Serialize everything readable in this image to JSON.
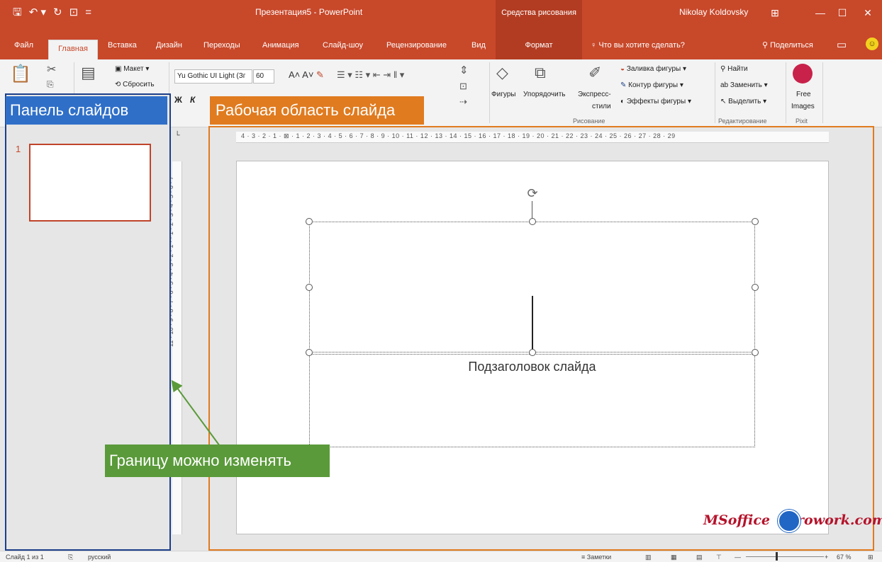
{
  "window": {
    "qat_icons": [
      "save-icon",
      "undo-icon",
      "redo-icon",
      "start-slideshow-icon",
      "customize-qat-icon"
    ],
    "qat_glyphs": [
      "🖫",
      "↶ ▾",
      "↻",
      "⊡",
      "="
    ],
    "document_title": "Презентация5 - PowerPoint",
    "contextual_group": "Средства рисования",
    "user": "Nikolay Koldovsky",
    "controls": [
      "⊞",
      "—",
      "☐",
      "✕"
    ]
  },
  "tabs": {
    "file": "Файл",
    "home": "Главная",
    "insert": "Вставка",
    "design": "Дизайн",
    "transitions": "Переходы",
    "animations": "Анимация",
    "slideshow": "Слайд-шоу",
    "review": "Рецензирование",
    "view": "Вид",
    "format": "Формат",
    "tell_me": "Что вы хотите сделать?",
    "tell_me_icon": "lightbulb-icon",
    "share": "Поделиться",
    "share_icon": "person-icon"
  },
  "ribbon": {
    "layout_label": "Макет",
    "reset_label": "Сбросить",
    "font_name": "Yu Gothic UI Light (Зг",
    "font_size": "60",
    "bold": "Ж",
    "italic": "К",
    "shapes_label": "Фигуры",
    "arrange_label": "Упорядочить",
    "quick_styles_label": "Экспресс-",
    "quick_styles_label2": "стили",
    "shape_fill": "Заливка фигуры",
    "shape_outline": "Контур фигуры",
    "shape_effects": "Эффекты фигуры",
    "find": "Найти",
    "replace": "Заменить",
    "select": "Выделить",
    "free_images_1": "Free",
    "free_images_2": "Images",
    "group_drawing": "Рисование",
    "group_editing": "Редактирование",
    "group_pixit": "Pixit"
  },
  "ruler": {
    "horizontal": "4 · 3 · 2 · 1 · ⊠ · 1 · 2 · 3 · 4 · 5 · 6 · 7 · 8 · 9 · 10 · 11 · 12 · 13 · 14 · 15 · 16 · 17 · 18 · 19 · 20 · 21 · 22 · 23 · 24 · 25 · 26 · 27 · 28 · 29",
    "vertical": "11 · 10 · 9 · 8 · 7 · 6 · 5 · 4 · 3 · 2 · 1 · · 1 · 2 · 3 · 4 · 5 · 6 · 7"
  },
  "slide_panel": {
    "thumbnail_number": "1"
  },
  "slide": {
    "subtitle_placeholder": "Подзаголовок слайда"
  },
  "callouts": {
    "slide_panel": "Панель слайдов",
    "work_area": "Рабочая область слайда",
    "border_resizable": "Границу можно изменять"
  },
  "watermark": {
    "text_left": "MSoffice",
    "text_right": "rowork.com"
  },
  "statusbar": {
    "slide_info": "Слайд 1 из 1",
    "language": "русский",
    "notes": "Заметки",
    "zoom": "67 %"
  },
  "colors": {
    "accent": "#c8482a",
    "panel_outline": "#1c3f8a",
    "work_outline": "#e07b1f",
    "callout_green": "#5a9a3a"
  }
}
